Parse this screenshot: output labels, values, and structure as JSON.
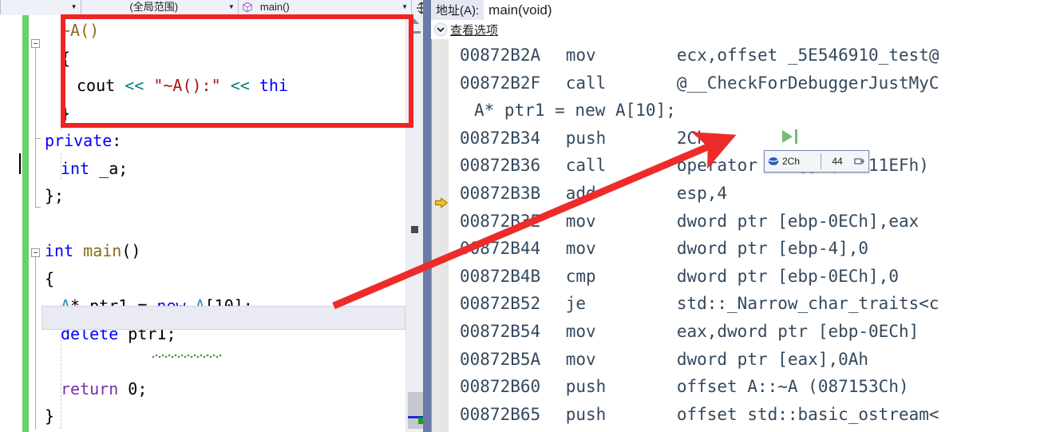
{
  "editor": {
    "nav_bar": {
      "back_caret": "▼",
      "scope_selector": "(全局范围)",
      "member_selector": "main()",
      "member_icon": "method-icon",
      "split_icon": "split-window-icon",
      "caret_glyph": "▼"
    },
    "code_lines": [
      {
        "indent": 1,
        "text": "~A()",
        "tokens": [
          {
            "t": "~A()",
            "c": "tok-func"
          }
        ]
      },
      {
        "indent": 1,
        "text": "{",
        "tokens": [
          {
            "t": "{",
            "c": "tok-plain"
          }
        ]
      },
      {
        "indent": 2,
        "text": "cout << \"~A():\" << thi",
        "tokens": [
          {
            "t": "cout ",
            "c": "tok-plain"
          },
          {
            "t": "<< ",
            "c": "tok-op"
          },
          {
            "t": "\"~A():\"",
            "c": "tok-str"
          },
          {
            "t": " ",
            "c": "tok-plain"
          },
          {
            "t": "<< ",
            "c": "tok-op"
          },
          {
            "t": "thi",
            "c": "tok-kw"
          }
        ]
      },
      {
        "indent": 1,
        "text": "}",
        "tokens": [
          {
            "t": "}",
            "c": "tok-plain"
          }
        ]
      },
      {
        "indent": 0,
        "text": "private:",
        "tokens": [
          {
            "t": "private",
            "c": "tok-kw"
          },
          {
            "t": ":",
            "c": "tok-plain"
          }
        ]
      },
      {
        "indent": 1,
        "text": "int _a;",
        "tokens": [
          {
            "t": "int",
            "c": "tok-kw"
          },
          {
            "t": " _a;",
            "c": "tok-plain"
          }
        ]
      },
      {
        "indent": 0,
        "text": "};",
        "tokens": [
          {
            "t": "};",
            "c": "tok-plain"
          }
        ]
      },
      {
        "indent": 0,
        "text": "",
        "tokens": []
      },
      {
        "indent": 0,
        "text": "int main()",
        "tokens": [
          {
            "t": "int",
            "c": "tok-kw"
          },
          {
            "t": " ",
            "c": "tok-plain"
          },
          {
            "t": "main",
            "c": "tok-func"
          },
          {
            "t": "()",
            "c": "tok-plain"
          }
        ]
      },
      {
        "indent": 0,
        "text": "{",
        "tokens": [
          {
            "t": "{",
            "c": "tok-plain"
          }
        ]
      },
      {
        "indent": 1,
        "text": "A* ptr1 = new A[10];",
        "tokens": [
          {
            "t": "A",
            "c": "tok-type"
          },
          {
            "t": "* ptr1 = ",
            "c": "tok-plain"
          },
          {
            "t": "new",
            "c": "tok-kw"
          },
          {
            "t": " ",
            "c": "tok-plain"
          },
          {
            "t": "A",
            "c": "tok-type"
          },
          {
            "t": "[10];",
            "c": "tok-plain"
          }
        ]
      },
      {
        "indent": 1,
        "text": "delete ptr1;",
        "tokens": [
          {
            "t": "delete",
            "c": "tok-kw"
          },
          {
            "t": " ptr1;",
            "c": "tok-plain"
          }
        ]
      },
      {
        "indent": 0,
        "text": "",
        "tokens": []
      },
      {
        "indent": 1,
        "text": "return 0;",
        "tokens": [
          {
            "t": "return",
            "c": "tok-kw2"
          },
          {
            "t": " 0;",
            "c": "tok-plain"
          }
        ]
      },
      {
        "indent": 0,
        "text": "}",
        "tokens": [
          {
            "t": "}",
            "c": "tok-plain"
          }
        ]
      }
    ],
    "scrollbar": {
      "up_arrow": "scroll-up-arrow",
      "thumb": "scroll-thumb"
    }
  },
  "disassembly": {
    "address_label": "地址(A):",
    "address_value": "main(void)",
    "view_options_label": "查看选项",
    "view_options_chevron": "⌄",
    "instruction_pointer_address": "00872B36",
    "lines": [
      {
        "kind": "asm",
        "address": "00872B2A",
        "mnemonic": "mov",
        "operands": "ecx,offset _5E546910_test@"
      },
      {
        "kind": "asm",
        "address": "00872B2F",
        "mnemonic": "call",
        "operands": "@__CheckForDebuggerJustMyC"
      },
      {
        "kind": "source",
        "address": "",
        "mnemonic": "",
        "operands": "A* ptr1 = new A[10];"
      },
      {
        "kind": "asm",
        "address": "00872B34",
        "mnemonic": "push",
        "operands": "2Ch"
      },
      {
        "kind": "asm",
        "address": "00872B36",
        "mnemonic": "call",
        "operands": "operator new[] (08711EFh)",
        "current": true
      },
      {
        "kind": "asm",
        "address": "00872B3B",
        "mnemonic": "add",
        "operands": "esp,4"
      },
      {
        "kind": "asm",
        "address": "00872B3E",
        "mnemonic": "mov",
        "operands": "dword ptr [ebp-0ECh],eax"
      },
      {
        "kind": "asm",
        "address": "00872B44",
        "mnemonic": "mov",
        "operands": "dword ptr [ebp-4],0"
      },
      {
        "kind": "asm",
        "address": "00872B4B",
        "mnemonic": "cmp",
        "operands": "dword ptr [ebp-0ECh],0"
      },
      {
        "kind": "asm",
        "address": "00872B52",
        "mnemonic": "je",
        "operands": "std::_Narrow_char_traits<c"
      },
      {
        "kind": "asm",
        "address": "00872B54",
        "mnemonic": "mov",
        "operands": "eax,dword ptr [ebp-0ECh]"
      },
      {
        "kind": "asm",
        "address": "00872B5A",
        "mnemonic": "mov",
        "operands": "dword ptr [eax],0Ah"
      },
      {
        "kind": "asm",
        "address": "00872B60",
        "mnemonic": "push",
        "operands": "offset A::~A (087153Ch)"
      },
      {
        "kind": "asm",
        "address": "00872B65",
        "mnemonic": "push",
        "operands": "offset std::basic_ostream<"
      }
    ],
    "datatip": {
      "icon": "watch-value-icon",
      "name": "2Ch",
      "value": "44",
      "pin_icon": "pin-icon"
    },
    "run_to_cursor_icon": "run-to-cursor-icon"
  },
  "annotations": {
    "highlight_box_color": "#ef2424",
    "arrow_color": "#ee2b2b",
    "arrow_from": "A* ptr1 = new A[10];",
    "arrow_to": "push 2Ch"
  }
}
